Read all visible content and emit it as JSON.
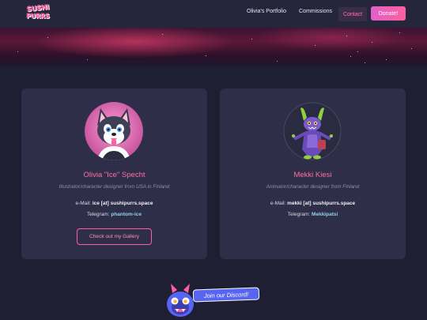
{
  "nav": {
    "logo": {
      "line1": "SUSHI",
      "line2": "PURRS"
    },
    "links": [
      "Olivia's Portfolio",
      "Commissions"
    ],
    "contact_label": "Contact",
    "donate_label": "Donate!"
  },
  "artists": [
    {
      "name": "Olivia \"Ice\" Specht",
      "role": "Illustrator/character designer from USA in Finland",
      "email_label": "e-Mail:",
      "email": "ice [at] sushipurrs.space",
      "telegram_label": "Telegram:",
      "telegram": "phantom-ice",
      "gallery_label": "Check out my Gallery",
      "avatar_icon": "husky-avatar-icon"
    },
    {
      "name": "Mekki Kiesi",
      "role": "Animator/character designer from Finland",
      "email_label": "e-Mail:",
      "email": "mekki [at] sushipurrs.space",
      "telegram_label": "Telegram:",
      "telegram": "Mekkipatsi",
      "avatar_icon": "purple-creature-avatar-icon"
    }
  ],
  "discord": {
    "label": "Join our Discord!",
    "icon": "discord-mascot-icon"
  },
  "colors": {
    "background": "#1f1f33",
    "card": "#2e2e48",
    "accent_pink": "#ff5fa0",
    "telegram_blue": "#8fd0f0"
  }
}
